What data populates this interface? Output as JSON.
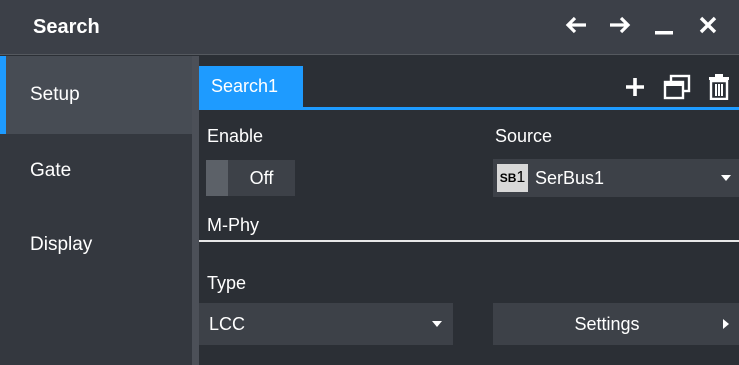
{
  "window": {
    "title": "Search",
    "controls": [
      "arrow-left-icon",
      "arrow-right-icon",
      "minimize-icon",
      "close-icon"
    ]
  },
  "sidebar": {
    "items": [
      {
        "label": "Setup",
        "active": true
      },
      {
        "label": "Gate",
        "active": false
      },
      {
        "label": "Display",
        "active": false
      }
    ]
  },
  "tabs": {
    "active_label": "Search1",
    "tools": [
      "plus-icon",
      "copy-window-icon",
      "trash-icon"
    ]
  },
  "enable": {
    "label": "Enable",
    "value": "Off"
  },
  "source": {
    "label": "Source",
    "badge_prefix": "SB",
    "badge_number": "1",
    "value": "SerBus1"
  },
  "section": {
    "label": "M-Phy"
  },
  "type": {
    "label": "Type",
    "value": "LCC"
  },
  "settings": {
    "label": "Settings"
  },
  "colors": {
    "accent": "#1e9bff",
    "background": "#2b2f35",
    "titlebar": "#3c4048",
    "control": "#3d4148"
  }
}
